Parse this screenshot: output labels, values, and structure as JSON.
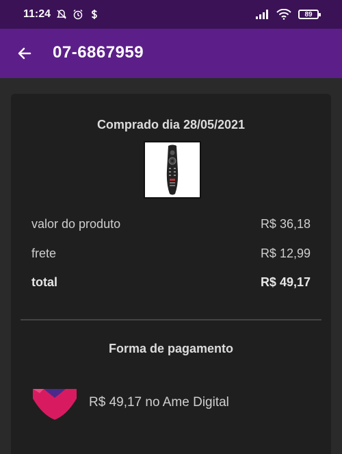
{
  "status_bar": {
    "time": "11:24",
    "battery": "89",
    "icons": [
      "bell-off-icon",
      "alarm-icon",
      "dollar-icon",
      "signal-icon",
      "wifi-icon",
      "battery-icon"
    ]
  },
  "app_bar": {
    "title": "07-6867959",
    "back_icon": "arrow-left-icon"
  },
  "order": {
    "purchase_date": "Comprado dia 28/05/2021",
    "product_image": "tv-remote-control",
    "rows": [
      {
        "label": "valor do produto",
        "value": "R$ 36,18"
      },
      {
        "label": "frete",
        "value": "R$ 12,99"
      },
      {
        "label": "total",
        "value": "R$ 49,17"
      }
    ]
  },
  "payment": {
    "title": "Forma de pagamento",
    "text": "R$ 49,17 no Ame Digital",
    "logo": "ame-digital-logo",
    "colors": {
      "logo_primary": "#d81b60",
      "logo_secondary": "#4a2a8a"
    }
  },
  "colors": {
    "status_bar": "#3b1256",
    "app_bar": "#5c1f8a",
    "background": "#2a2a2a",
    "card": "#1f1f1f"
  }
}
